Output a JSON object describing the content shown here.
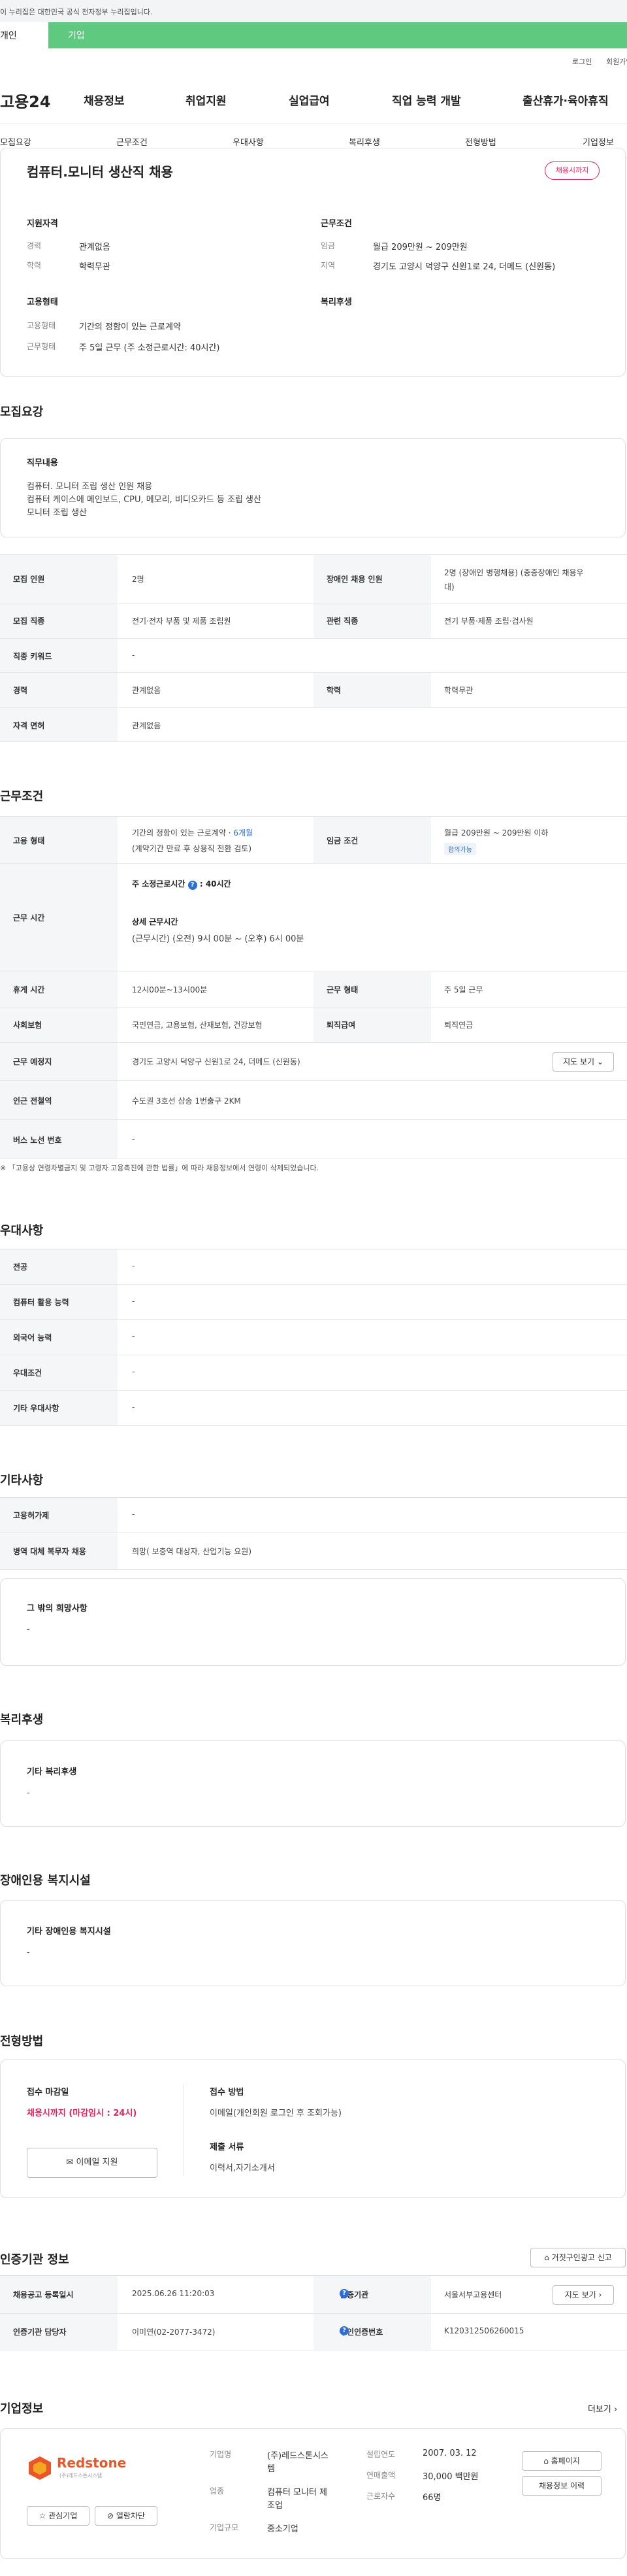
{
  "gov_banner": "이 누리집은 대한민국 공식 전자정부 누리집입니다.",
  "service_tabs": {
    "personal": "개인",
    "company": "기업"
  },
  "util": {
    "login": "로그인",
    "signup": "회원가입"
  },
  "nav": {
    "logo": "고용24",
    "items": [
      "채용정보",
      "취업지원",
      "실업급여",
      "직업 능력 개발",
      "출산휴가·육아휴직"
    ]
  },
  "section_tabs": [
    "모집요강",
    "근무조건",
    "우대사항",
    "복리후생",
    "전형방법",
    "기업정보"
  ],
  "summary": {
    "title": "컴퓨터.모니터 생산직 채용",
    "badge": "채용시까지",
    "qual_title": "지원자격",
    "qual": [
      {
        "label": "경력",
        "value": "관계없음"
      },
      {
        "label": "학력",
        "value": "학력무관"
      }
    ],
    "cond_title": "근무조건",
    "cond": [
      {
        "label": "임금",
        "value": "월급 209만원 ~ 209만원"
      },
      {
        "label": "지역",
        "value": "경기도 고양시 덕양구 신원1로 24, 더메드 (신원동)"
      }
    ],
    "emp_title": "고용형태",
    "emp": [
      {
        "label": "고용형태",
        "value": "기간의 정함이 있는 근로계약"
      },
      {
        "label": "근무형태",
        "value": "주 5일 근무 (주 소정근로시간: 40시간)"
      }
    ],
    "welfare_title": "복리후생"
  },
  "recruit": {
    "title": "모집요강",
    "job_title": "직무내용",
    "job_lines": [
      "컴퓨터. 모니터 조립 생산 인원 채용",
      "컴퓨터 케이스에 메인보드, CPU, 메모리, 비디오카드 등 조립 생산",
      "모니터 조립 생산"
    ],
    "rows": [
      {
        "th1": "모집 인원",
        "td1": "2명",
        "th2": "장애인 채용 인원",
        "td2a": "2명 (장애인 병행채용) (중증장애인 채용우",
        "td2b": "대)"
      },
      {
        "th1": "모집 직종",
        "td1": "전기·전자 부품 및 제품 조립원",
        "th2": "관련 직종",
        "td2a": "전기 부품·제품 조립·검사원"
      },
      {
        "th1": "직종 키워드",
        "td1": "-"
      },
      {
        "th1": "경력",
        "td1": "관계없음",
        "th2": "학력",
        "td2a": "학력무관"
      },
      {
        "th1": "자격 면허",
        "td1": "관계없음"
      }
    ]
  },
  "work": {
    "title": "근무조건",
    "employ_type_label": "고용 형태",
    "employ_type_value": "기간의 정함이 있는 근로계약 · ",
    "employ_type_months": "6개월",
    "employ_type_note": "(계약기간 만료 후 상용직 전환 검토)",
    "wage_label": "임금 조건",
    "wage_value": "월급 209만원 ~ 209만원 이하",
    "wage_badge": "협의가능",
    "hours_label": "근무 시간",
    "hours_std": "주 소정근로시간",
    "hours_std_val": ": 40시간",
    "hours_detail_title": "상세 근무시간",
    "hours_detail": "(근무시간) (오전) 9시 00분 ~ (오후) 6시 00분",
    "rows": [
      {
        "th1": "휴게 시간",
        "td1": "12시00분~13시00분",
        "th2": "근무 형태",
        "td2": "주 5일 근무"
      },
      {
        "th1": "사회보험",
        "td1": "국민연금, 고용보험, 산재보험, 건강보험",
        "th2": "퇴직급여",
        "td2": "퇴직연금"
      },
      {
        "th1": "근무 예정지",
        "td1": "경기도 고양시 덕양구 신원1로 24, 더메드 (신원동)",
        "btn": "지도 보기"
      },
      {
        "th1": "인근 전철역",
        "td1": "수도권 3호선 삼송 1번출구 2KM"
      },
      {
        "th1": "버스 노선 번호",
        "td1": "-"
      }
    ],
    "footnote": "「고용상 연령차별금지 및 고령자 고용촉진에 관한 법률」에 따라 채용정보에서 연령이 삭제되었습니다."
  },
  "prefer": {
    "title": "우대사항",
    "rows": [
      {
        "th": "전공",
        "td": "-"
      },
      {
        "th": "컴퓨터 활용 능력",
        "td": "-"
      },
      {
        "th": "외국어 능력",
        "td": "-"
      },
      {
        "th": "우대조건",
        "td": "-"
      },
      {
        "th": "기타 우대사항",
        "td": "-"
      }
    ]
  },
  "etc": {
    "title": "기타사항",
    "rows": [
      {
        "th": "고용허가제",
        "td": "-"
      },
      {
        "th": "병역 대체 복무자 채용",
        "td": "희망( 보충역 대상자, 산업기능 요원)"
      }
    ],
    "other_title": "그 밖의 희망사항",
    "other_value": "-"
  },
  "welfare": {
    "title": "복리후생",
    "sub": "기타 복리후생",
    "value": "-"
  },
  "disability": {
    "title": "장애인용 복지시설",
    "sub": "기타 장애인용 복지시설",
    "value": "-"
  },
  "selection": {
    "title": "전형방법",
    "deadline_title": "접수 마감일",
    "deadline_value": "채용시까지 (마감임시 : 24시)",
    "email_btn": "이메일 지원",
    "method_title": "접수 방법",
    "method_value": "이메일(개인회원 로그인 후 조회가능)",
    "docs_title": "제출 서류",
    "docs_value": "이력서,자기소개서"
  },
  "cert": {
    "title": "인증기관 정보",
    "report_btn": "거짓구인광고 신고",
    "rows": [
      {
        "th1": "채용공고 등록일시",
        "td1": "2025.06.26 11:20:03",
        "th2": "인증기관",
        "td2": "서울서부고용센터",
        "btn": "지도 보기"
      },
      {
        "th1": "인증기관 담당자",
        "td1": "이미연(02-2077-3472)",
        "th2": "구인인증번호",
        "td2": "K120312506260015"
      }
    ]
  },
  "company": {
    "title": "기업정보",
    "more": "더보기",
    "logo_text": "Redstone",
    "logo_sub": "(주)레드스톤시스템",
    "fav_btn": "관심기업",
    "block_btn": "열람차단",
    "name_label": "기업명",
    "name_lines": [
      "(주)레드스톤시스",
      "템"
    ],
    "biz_label": "업종",
    "biz_lines": [
      "컴퓨터 모니터 제",
      "조업"
    ],
    "size_label": "기업규모",
    "size_value": "중소기업",
    "founded_label": "설립연도",
    "founded_value": "2007. 03. 12",
    "sales_label": "연매출액",
    "sales_value": "30,000 백만원",
    "staff_label": "근로자수",
    "staff_value": "66명",
    "home_btn": "홈페이지",
    "history_btn": "채용정보 이력"
  },
  "colors": {
    "green": "#5ec97f",
    "accent_red": "#e0245e",
    "link_blue": "#2c6dd8"
  }
}
